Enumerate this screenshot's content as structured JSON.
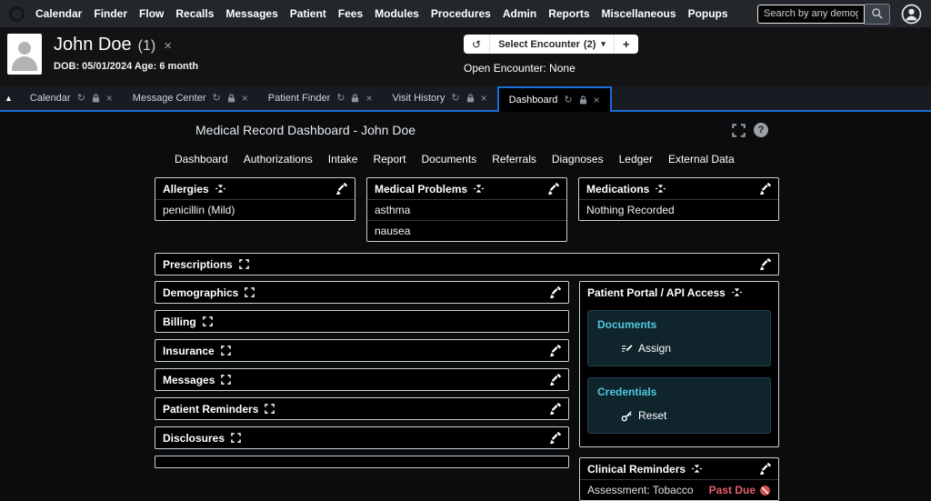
{
  "glyphs": {
    "close": "×",
    "caret_up": "▲",
    "caret_down": "▾",
    "refresh": "↻",
    "history": "↺",
    "plus": "+",
    "help": "?"
  },
  "topnav": {
    "menu": [
      "Calendar",
      "Finder",
      "Flow",
      "Recalls",
      "Messages",
      "Patient",
      "Fees",
      "Modules",
      "Procedures",
      "Admin",
      "Reports",
      "Miscellaneous",
      "Popups"
    ],
    "search_placeholder": "Search by any demographics"
  },
  "patient": {
    "name": "John Doe",
    "count": "(1)",
    "dob_age": "DOB: 05/01/2024 Age: 6 month",
    "select_encounter": "Select Encounter",
    "encounter_count": "(2)",
    "open_encounter": "Open Encounter: None"
  },
  "tabs": [
    {
      "label": "Calendar"
    },
    {
      "label": "Message Center"
    },
    {
      "label": "Patient Finder"
    },
    {
      "label": "Visit History"
    },
    {
      "label": "Dashboard"
    }
  ],
  "main": {
    "title": "Medical Record Dashboard - John Doe",
    "nav": [
      "Dashboard",
      "Authorizations",
      "Intake",
      "Report",
      "Documents",
      "Referrals",
      "Diagnoses",
      "Ledger",
      "External Data"
    ]
  },
  "cards": {
    "allergies": {
      "title": "Allergies",
      "items": [
        "penicillin (Mild)"
      ]
    },
    "medical_problems": {
      "title": "Medical Problems",
      "items": [
        "asthma",
        "nausea"
      ]
    },
    "medications": {
      "title": "Medications",
      "items": [
        "Nothing Recorded"
      ]
    },
    "prescriptions": {
      "title": "Prescriptions"
    },
    "demographics": {
      "title": "Demographics"
    },
    "billing": {
      "title": "Billing"
    },
    "insurance": {
      "title": "Insurance"
    },
    "messages": {
      "title": "Messages"
    },
    "patient_reminders": {
      "title": "Patient Reminders"
    },
    "disclosures": {
      "title": "Disclosures"
    },
    "portal": {
      "title": "Patient Portal / API Access",
      "sections": [
        {
          "heading": "Documents",
          "action": "Assign"
        },
        {
          "heading": "Credentials",
          "action": "Reset"
        }
      ]
    },
    "clinical_reminders": {
      "title": "Clinical Reminders",
      "rows": [
        {
          "label": "Assessment: Tobacco",
          "status": "Past Due"
        }
      ]
    }
  },
  "colors": {
    "accent_blue": "#1a6ed8",
    "info_teal": "#4ec9de",
    "danger_red": "#e4606d",
    "card_border": "#ccd1d6"
  }
}
